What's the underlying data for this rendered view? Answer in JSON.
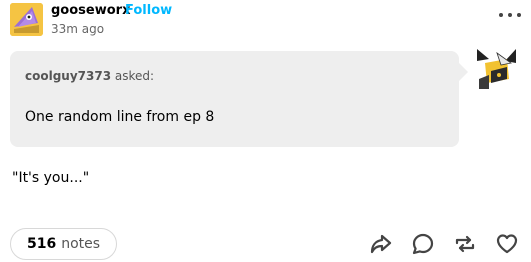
{
  "post": {
    "blog_name": "gooseworx",
    "follow_label": "Follow",
    "timestamp": "33m ago"
  },
  "ask": {
    "asker": "coolguy7373",
    "asked_label": "asked:",
    "question": "One random line from ep 8"
  },
  "answer": "\"It's you...\"",
  "footer": {
    "notes_count": "516",
    "notes_label": "notes"
  },
  "icons": [
    "more-icon",
    "share-icon",
    "reply-icon",
    "reblog-icon",
    "like-icon"
  ],
  "colors": {
    "follow": "#00b8ff",
    "ask_background": "#eeeeee",
    "avatar_background": "#f5c443"
  }
}
